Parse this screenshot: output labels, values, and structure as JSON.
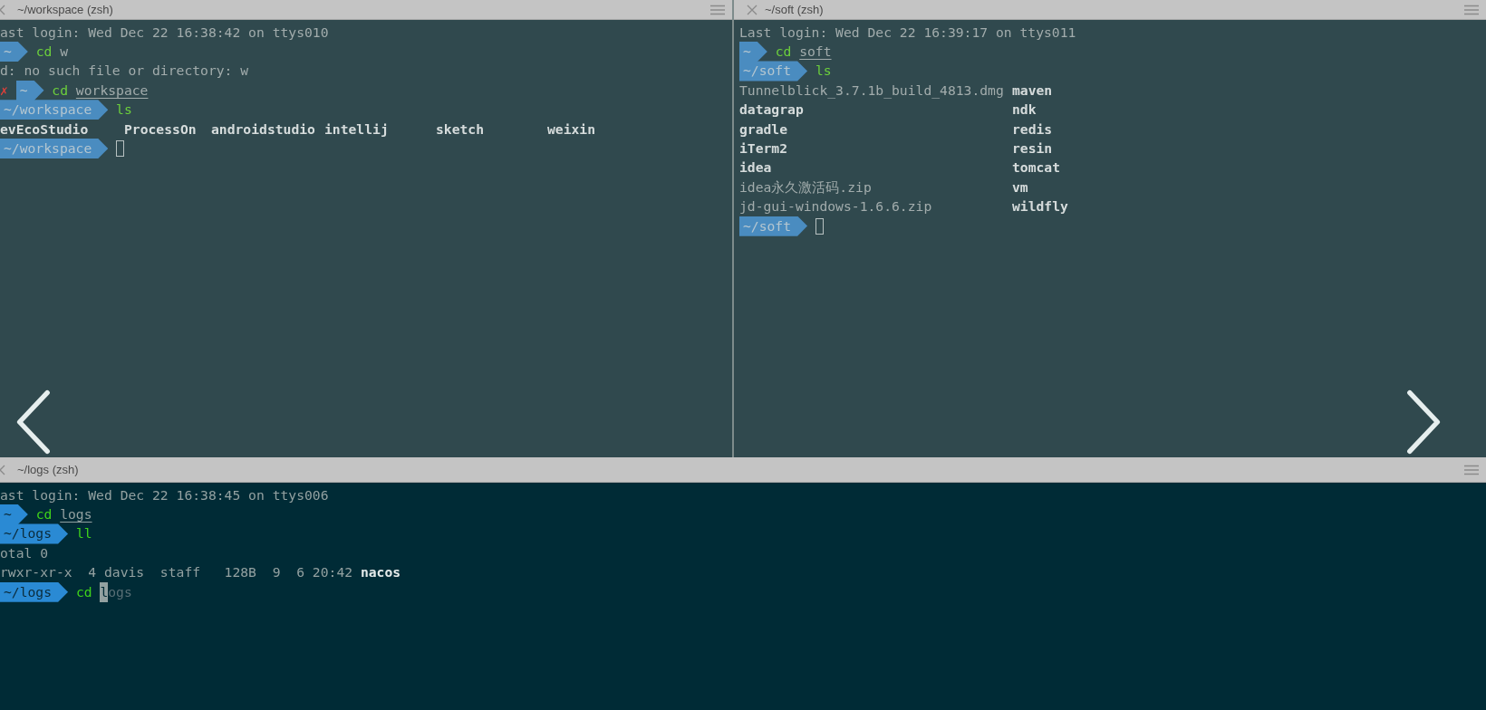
{
  "top_panes": [
    {
      "title": "~/workspace (zsh)",
      "active": false,
      "lines": [
        {
          "kind": "text",
          "segments": [
            {
              "kind": "plain",
              "text": "ast login: Wed Dec 22 16:38:42 on ttys010"
            }
          ]
        },
        {
          "kind": "text",
          "segments": [
            {
              "kind": "prompt",
              "text": "~"
            },
            {
              "kind": "command",
              "text": "cd"
            },
            {
              "kind": "plain",
              "text": "w"
            }
          ]
        },
        {
          "kind": "text",
          "segments": [
            {
              "kind": "plain",
              "text": "d: no such file or directory: w"
            }
          ]
        },
        {
          "kind": "text",
          "segments": [
            {
              "kind": "error",
              "text": "✗"
            },
            {
              "kind": "prompt",
              "text": "~"
            },
            {
              "kind": "command",
              "text": "cd"
            },
            {
              "kind": "path",
              "text": "workspace"
            }
          ]
        },
        {
          "kind": "text",
          "segments": [
            {
              "kind": "prompt",
              "text": "~/workspace"
            },
            {
              "kind": "command",
              "text": "ls"
            }
          ]
        },
        {
          "kind": "columns",
          "cells": [
            "evEcoStudio",
            "ProcessOn",
            "androidstudio",
            "intellij",
            "sketch",
            "weixin"
          ]
        },
        {
          "kind": "text",
          "segments": [
            {
              "kind": "prompt",
              "text": "~/workspace"
            },
            {
              "kind": "cursor"
            }
          ]
        }
      ]
    },
    {
      "title": "~/soft (zsh)",
      "active": false,
      "lines": [
        {
          "kind": "text",
          "segments": [
            {
              "kind": "plain",
              "text": "Last login: Wed Dec 22 16:39:17 on ttys011"
            }
          ]
        },
        {
          "kind": "text",
          "segments": [
            {
              "kind": "prompt",
              "text": "~"
            },
            {
              "kind": "command",
              "text": "cd"
            },
            {
              "kind": "path",
              "text": "soft"
            }
          ]
        },
        {
          "kind": "text",
          "segments": [
            {
              "kind": "prompt",
              "text": "~/soft"
            },
            {
              "kind": "command",
              "text": "ls"
            }
          ]
        },
        {
          "kind": "pair",
          "cells": [
            {
              "text": "Tunnelblick_3.7.1b_build_4813.dmg",
              "bold": false
            },
            {
              "text": "maven",
              "bold": true
            }
          ]
        },
        {
          "kind": "pair",
          "cells": [
            {
              "text": "datagrap",
              "bold": true
            },
            {
              "text": "ndk",
              "bold": true
            }
          ]
        },
        {
          "kind": "pair",
          "cells": [
            {
              "text": "gradle",
              "bold": true
            },
            {
              "text": "redis",
              "bold": true
            }
          ]
        },
        {
          "kind": "pair",
          "cells": [
            {
              "text": "iTerm2",
              "bold": true
            },
            {
              "text": "resin",
              "bold": true
            }
          ]
        },
        {
          "kind": "pair",
          "cells": [
            {
              "text": "idea",
              "bold": true
            },
            {
              "text": "tomcat",
              "bold": true
            }
          ]
        },
        {
          "kind": "pair",
          "cells": [
            {
              "text": "idea永久激活码.zip",
              "bold": false
            },
            {
              "text": "vm",
              "bold": true
            }
          ]
        },
        {
          "kind": "pair",
          "cells": [
            {
              "text": "jd-gui-windows-1.6.6.zip",
              "bold": false
            },
            {
              "text": "wildfly",
              "bold": true
            }
          ]
        },
        {
          "kind": "text",
          "segments": [
            {
              "kind": "prompt",
              "text": "~/soft"
            },
            {
              "kind": "cursor"
            }
          ]
        }
      ]
    }
  ],
  "bottom_pane": {
    "title": "~/logs (zsh)",
    "active": true,
    "lines": [
      {
        "kind": "text",
        "segments": [
          {
            "kind": "plain",
            "text": "ast login: Wed Dec 22 16:38:45 on ttys006"
          }
        ]
      },
      {
        "kind": "text",
        "segments": [
          {
            "kind": "prompt",
            "text": "~"
          },
          {
            "kind": "command",
            "text": "cd"
          },
          {
            "kind": "path",
            "text": "logs"
          }
        ]
      },
      {
        "kind": "text",
        "segments": [
          {
            "kind": "prompt",
            "text": "~/logs"
          },
          {
            "kind": "command",
            "text": "ll"
          }
        ]
      },
      {
        "kind": "text",
        "segments": [
          {
            "kind": "plain",
            "text": "otal 0"
          }
        ]
      },
      {
        "kind": "text",
        "segments": [
          {
            "kind": "plain",
            "text": "rwxr-xr-x  4 davis  staff   128B  9  6 20:42"
          },
          {
            "kind": "bold",
            "text": "nacos"
          }
        ]
      },
      {
        "kind": "text",
        "segments": [
          {
            "kind": "prompt",
            "text": "~/logs"
          },
          {
            "kind": "command",
            "text": "cd"
          },
          {
            "kind": "cursor_char",
            "text": "l"
          },
          {
            "kind": "suggestion",
            "text": "ogs"
          }
        ]
      }
    ]
  }
}
